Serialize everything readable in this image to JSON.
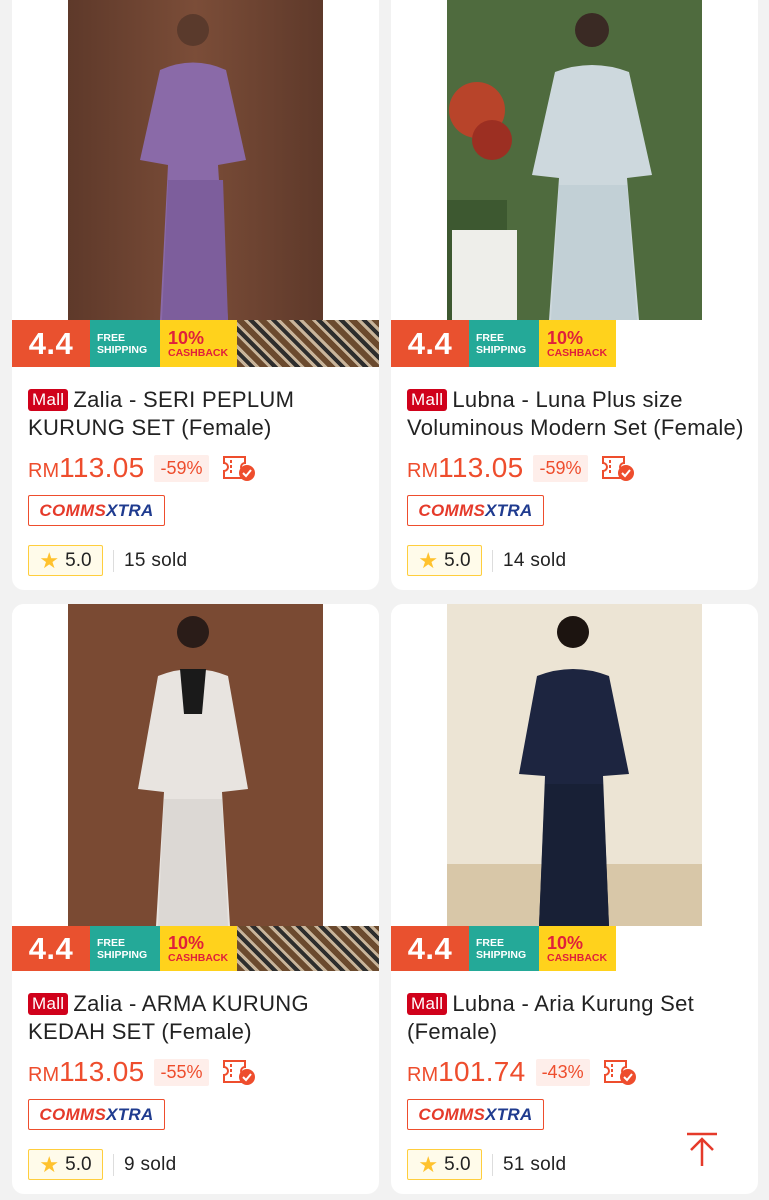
{
  "products": [
    {
      "mall_badge": "Mall",
      "name": "Zalia - SERI PEPLUM KURUNG SET (Female)",
      "currency": "RM",
      "price": "113.05",
      "discount": "-59%",
      "promo": {
        "tag": "4.4",
        "shipping_l1": "FREE",
        "shipping_l2": "SHIPPING",
        "cashback_pct": "10%",
        "cashback_lbl": "CASHBACK"
      },
      "comms_a": "COMMS",
      "comms_b": "XTRA",
      "rating": "5.0",
      "sold": "15 sold",
      "colors": {
        "bg": "#6e4534",
        "dress": "#8a6aa8"
      }
    },
    {
      "mall_badge": "Mall",
      "name": "Lubna - Luna Plus size Voluminous Modern Set (Female)",
      "currency": "RM",
      "price": "113.05",
      "discount": "-59%",
      "promo": {
        "tag": "4.4",
        "shipping_l1": "FREE",
        "shipping_l2": "SHIPPING",
        "cashback_pct": "10%",
        "cashback_lbl": "CASHBACK"
      },
      "comms_a": "COMMS",
      "comms_b": "XTRA",
      "rating": "5.0",
      "sold": "14 sold",
      "colors": {
        "bg": "#4f6b3e",
        "dress": "#cdd8dd"
      }
    },
    {
      "mall_badge": "Mall",
      "name": "Zalia - ARMA KURUNG KEDAH SET (Female)",
      "currency": "RM",
      "price": "113.05",
      "discount": "-55%",
      "promo": {
        "tag": "4.4",
        "shipping_l1": "FREE",
        "shipping_l2": "SHIPPING",
        "cashback_pct": "10%",
        "cashback_lbl": "CASHBACK"
      },
      "comms_a": "COMMS",
      "comms_b": "XTRA",
      "rating": "5.0",
      "sold": "9 sold",
      "colors": {
        "bg": "#7a4a33",
        "dress": "#e8e4e0"
      }
    },
    {
      "mall_badge": "Mall",
      "name": "Lubna - Aria Kurung Set (Female)",
      "currency": "RM",
      "price": "101.74",
      "discount": "-43%",
      "promo": {
        "tag": "4.4",
        "shipping_l1": "FREE",
        "shipping_l2": "SHIPPING",
        "cashback_pct": "10%",
        "cashback_lbl": "CASHBACK"
      },
      "comms_a": "COMMS",
      "comms_b": "XTRA",
      "rating": "5.0",
      "sold": "51 sold",
      "colors": {
        "bg": "#e6dccb",
        "dress": "#1d2540"
      }
    }
  ],
  "icons": {
    "voucher": "voucher-check-icon",
    "star": "star-icon",
    "back_to_top": "arrow-up-icon"
  },
  "accent": "#ee4d2d"
}
